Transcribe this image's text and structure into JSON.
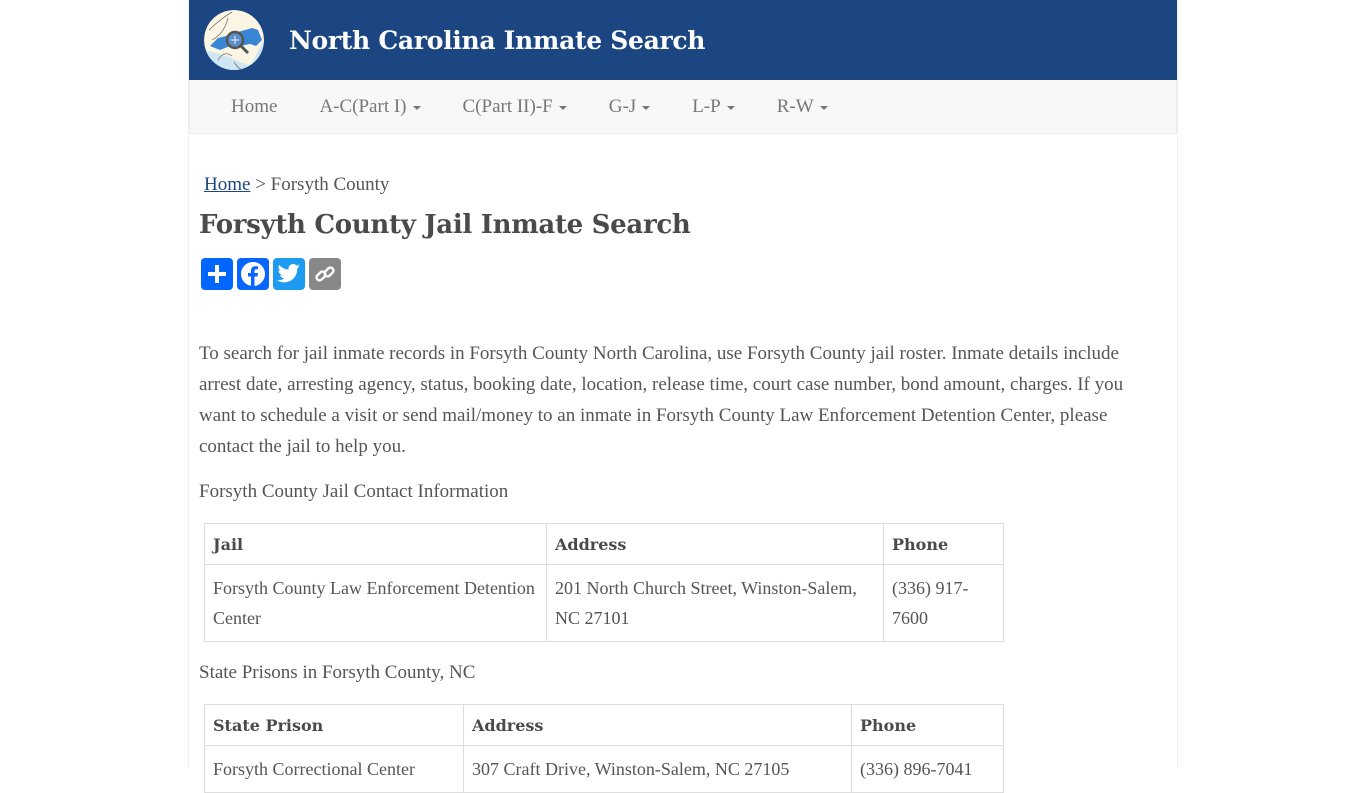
{
  "header": {
    "site_title": "North Carolina Inmate Search",
    "logo_icon": "nc-map-magnifier-logo",
    "brand_color": "#1c4681"
  },
  "nav": {
    "items": [
      {
        "label": "Home",
        "dropdown": false
      },
      {
        "label": "A-C(Part I)",
        "dropdown": true
      },
      {
        "label": "C(Part II)-F",
        "dropdown": true
      },
      {
        "label": "G-J",
        "dropdown": true
      },
      {
        "label": "L-P",
        "dropdown": true
      },
      {
        "label": "R-W",
        "dropdown": true
      }
    ]
  },
  "breadcrumb": {
    "home": "Home",
    "separator": ">",
    "current": "Forsyth County"
  },
  "page": {
    "title": "Forsyth County Jail Inmate Search",
    "share_buttons": [
      {
        "name": "share",
        "icon": "plus-icon",
        "color": "#0166ff"
      },
      {
        "name": "facebook",
        "icon": "facebook-icon",
        "color": "#0866ff"
      },
      {
        "name": "twitter",
        "icon": "twitter-icon",
        "color": "#1d9bf0"
      },
      {
        "name": "copy-link",
        "icon": "link-icon",
        "color": "#888888"
      }
    ],
    "intro": "To search for jail inmate records in Forsyth County North Carolina, use Forsyth County jail roster. Inmate details include arrest date, arresting agency, status, booking date, location, release time, court case number, bond amount, charges. If you want to schedule a visit or send mail/money to an inmate in Forsyth County Law Enforcement Detention Center, please contact the jail to help you.",
    "jail_section_label": "Forsyth County Jail Contact Information",
    "prison_section_label": "State Prisons in Forsyth County, NC"
  },
  "jail_table": {
    "headers": [
      "Jail",
      "Address",
      "Phone"
    ],
    "rows": [
      [
        "Forsyth County Law Enforcement Detention Center",
        "201 North Church Street, Winston-Salem, NC 27101",
        "(336) 917-7600"
      ]
    ]
  },
  "prison_table": {
    "headers": [
      "State Prison",
      "Address",
      "Phone"
    ],
    "rows": [
      [
        "Forsyth Correctional Center",
        "307 Craft Drive, Winston-Salem, NC 27105",
        "(336) 896-7041"
      ]
    ]
  }
}
